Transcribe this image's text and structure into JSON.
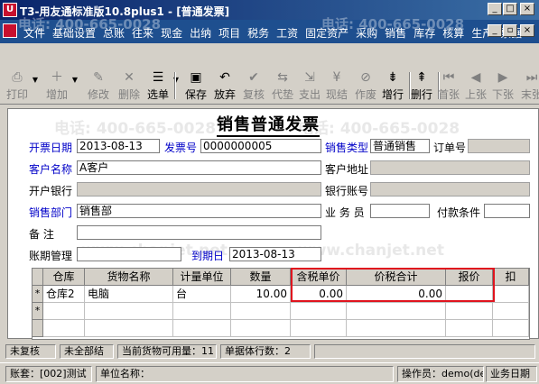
{
  "window": {
    "title": "T3-用友通标准版10.8plus1 - [普通发票]",
    "minimize_glyph": "_",
    "maximize_glyph": "□",
    "close_glyph": "×",
    "child_minimize_glyph": "_",
    "child_restore_glyph": "▫",
    "child_close_glyph": "×"
  },
  "menu": {
    "items": [
      "文件",
      "基础设置",
      "总账",
      "往来",
      "现金",
      "出纳",
      "项目",
      "税务",
      "工资",
      "固定资产",
      "采购",
      "销售",
      "库存",
      "核算",
      "生产",
      "票据"
    ],
    "watermark": "电话: 400-665-0028"
  },
  "toolbar": {
    "buttons": [
      {
        "label": "打印",
        "icon": "printer-icon",
        "enabled": false
      },
      {
        "label": "增加",
        "icon": "add-document-icon",
        "enabled": false
      },
      {
        "label": "修改",
        "icon": "edit-icon",
        "enabled": false
      },
      {
        "label": "删除",
        "icon": "delete-icon",
        "enabled": false
      },
      {
        "label": "选单",
        "icon": "select-list-icon",
        "enabled": true
      },
      {
        "label": "保存",
        "icon": "save-icon",
        "enabled": true
      },
      {
        "label": "放弃",
        "icon": "discard-icon",
        "enabled": true
      },
      {
        "label": "复核",
        "icon": "review-icon",
        "enabled": false
      },
      {
        "label": "代垫",
        "icon": "advance-payment-icon",
        "enabled": false
      },
      {
        "label": "支出",
        "icon": "expense-icon",
        "enabled": false
      },
      {
        "label": "现结",
        "icon": "cash-settle-icon",
        "enabled": false
      },
      {
        "label": "作废",
        "icon": "void-icon",
        "enabled": false
      },
      {
        "label": "增行",
        "icon": "add-row-icon",
        "enabled": true
      },
      {
        "label": "删行",
        "icon": "delete-row-icon",
        "enabled": true
      },
      {
        "label": "首张",
        "icon": "first-record-icon",
        "enabled": false
      },
      {
        "label": "上张",
        "icon": "previous-record-icon",
        "enabled": false
      },
      {
        "label": "下张",
        "icon": "next-record-icon",
        "enabled": false
      },
      {
        "label": "末张",
        "icon": "last-record-icon",
        "enabled": false
      }
    ]
  },
  "doc": {
    "title": "销售普通发票",
    "watermarks": [
      "电话: 400-665-0028",
      "www.chanjet.net",
      "电话: 400-665-0028",
      "www.chanjet.net",
      "电话: 400-665-0028",
      "www.chanjet.net"
    ]
  },
  "header": {
    "invoice_date_label": "开票日期",
    "invoice_date": "2013-08-13",
    "invoice_no_label": "发票号",
    "invoice_no": "0000000005",
    "sales_type_label": "销售类型",
    "sales_type": "普通销售",
    "order_no_label": "订单号",
    "order_no": "",
    "customer_label": "客户名称",
    "customer": "A客户",
    "customer_address_label": "客户地址",
    "customer_address": "",
    "bank_label": "开户银行",
    "bank": "",
    "bank_account_label": "银行账号",
    "bank_account": "",
    "dept_label": "销售部门",
    "dept": "销售部",
    "salesperson_label": "业 务 员",
    "salesperson": "",
    "payment_terms_label": "付款条件",
    "payment_terms": "",
    "remark_label": "备    注",
    "remark": "",
    "period_mgmt_label": "账期管理",
    "period_mgmt": "",
    "due_date_label": "到期日",
    "due_date": "2013-08-13"
  },
  "grid": {
    "columns": [
      "仓库",
      "货物名称",
      "计量单位",
      "数量",
      "含税单价",
      "价税合计",
      "报价",
      "扣"
    ],
    "rows": [
      {
        "marker": "*",
        "warehouse": "仓库2",
        "product": "电脑",
        "unit": "台",
        "qty": "10.00",
        "tax_price": "0.00",
        "total": "0.00",
        "quote": ""
      },
      {
        "marker": "*",
        "warehouse": "",
        "product": "",
        "unit": "",
        "qty": "",
        "tax_price": "",
        "total": "",
        "quote": ""
      }
    ]
  },
  "status": {
    "review": "未复核",
    "settle": "未全部结",
    "available_qty": "当前货物可用量：11",
    "row_count": "单据体行数：2"
  },
  "bottom": {
    "account_set": "账套：[002]测试",
    "company": "单位名称：",
    "operator": "操作员：demo(de",
    "business_date": "业务日期"
  }
}
